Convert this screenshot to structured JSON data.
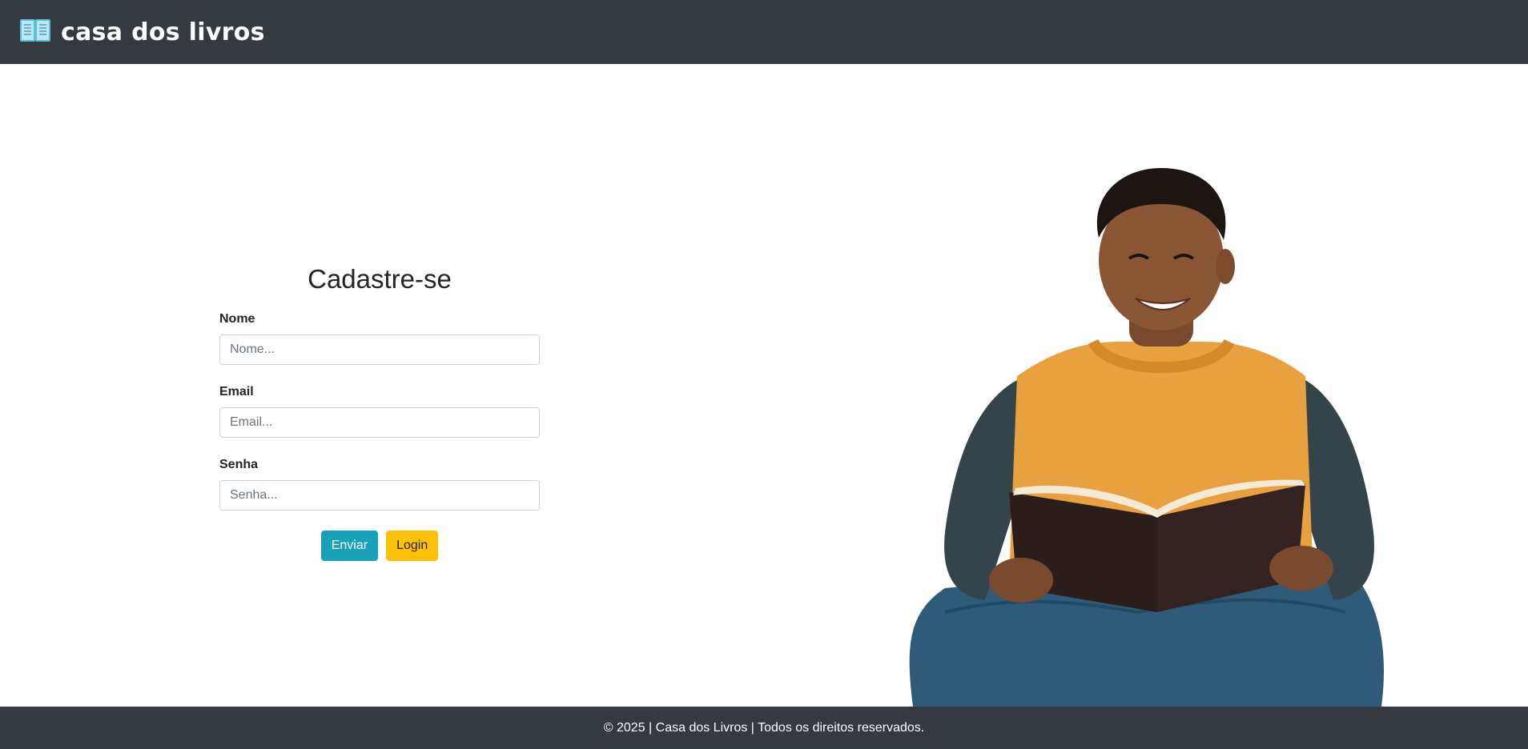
{
  "header": {
    "brand_text": "casa dos livros",
    "brand_icon": "open-book-icon"
  },
  "form": {
    "title": "Cadastre-se",
    "fields": [
      {
        "label": "Nome",
        "placeholder": "Nome...",
        "value": ""
      },
      {
        "label": "Email",
        "placeholder": "Email...",
        "value": ""
      },
      {
        "label": "Senha",
        "placeholder": "Senha...",
        "value": ""
      }
    ],
    "send_label": "Enviar",
    "login_label": "Login"
  },
  "hero": {
    "image_description": ""
  },
  "footer": {
    "text": "© 2025 | Casa dos Livros | Todos os direitos reservados."
  },
  "colors": {
    "navbar": "#343a40",
    "send_button": "#17a2b8",
    "login_button": "#ffc107",
    "book_icon": "#5bc0de"
  }
}
